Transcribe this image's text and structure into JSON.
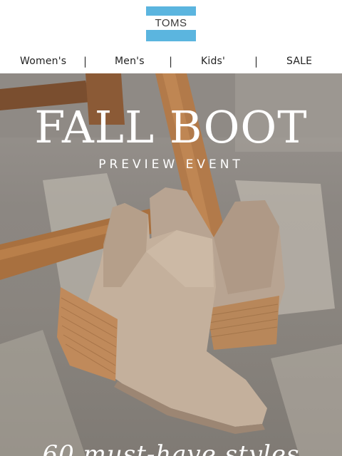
{
  "brand": {
    "logo_text": "TOMS",
    "logo_color": "#5bb5df"
  },
  "nav": {
    "items": [
      {
        "label": "Women's"
      },
      {
        "label": "Men's"
      },
      {
        "label": "Kids'"
      },
      {
        "label": "SALE"
      }
    ],
    "separator": "|"
  },
  "hero": {
    "title": "FALL BOOT",
    "subtitle": "PREVIEW EVENT",
    "bottom_text": "60 must-have styles"
  }
}
